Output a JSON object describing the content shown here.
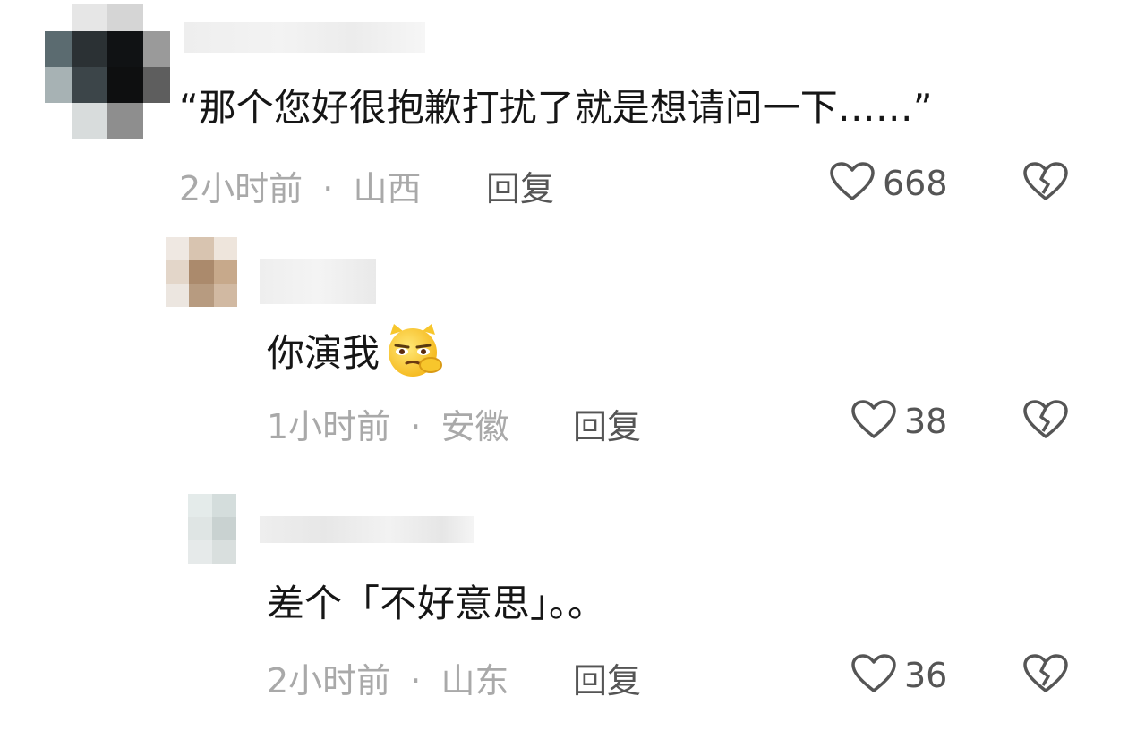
{
  "comments": [
    {
      "text": "“那个您好很抱歉打扰了就是想请问一下……”",
      "time": "2小时前",
      "separator": "·",
      "location": "山西",
      "reply_label": "回复",
      "likes": "668",
      "emoji": ""
    },
    {
      "text": "你演我",
      "time": "1小时前",
      "separator": "·",
      "location": "安徽",
      "reply_label": "回复",
      "likes": "38",
      "emoji": "smirk-cat-emoji"
    },
    {
      "text": "差个「不好意思」。。",
      "time": "2小时前",
      "separator": "·",
      "location": "山东",
      "reply_label": "回复",
      "likes": "36",
      "emoji": ""
    }
  ],
  "icons": {
    "like": "heart-outline-icon",
    "dislike": "broken-heart-icon"
  },
  "colors": {
    "meta_text": "#a9a9a9",
    "action_text": "#555555",
    "content_text": "#161616",
    "icon_stroke": "#555555"
  }
}
